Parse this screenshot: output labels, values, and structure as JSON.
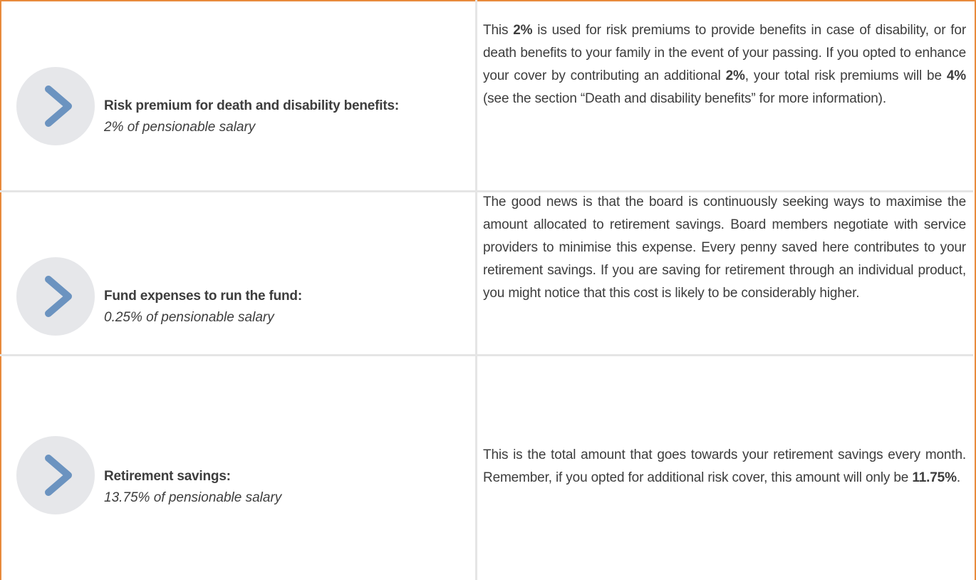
{
  "colors": {
    "border": "#e88a3c",
    "divider": "#e5e5e5",
    "chevron": "#6b93c0",
    "circle": "#e6e7ea"
  },
  "rows": [
    {
      "icon": "chevron-right-icon",
      "title": "Risk premium for death and disability benefits:",
      "subtitle": "2% of pensionable salary",
      "description_parts": [
        "This ",
        "2%",
        " is used for risk premiums to provide benefits in case of disability, or for death benefits to your family in the event of your passing. If you opted to enhance your cover by contributing an additional ",
        "2%",
        ", your total risk premiums will be ",
        "4%",
        " (see the section “Death and disability benefits” for more information)."
      ]
    },
    {
      "icon": "chevron-right-icon",
      "title": "Fund expenses to run the fund:",
      "subtitle": "0.25% of pensionable salary",
      "description": "The good news is that the board is continuously seeking ways to maximise the amount allocated to retirement savings. Board members negotiate with service providers to minimise this expense. Every penny saved here contributes to your retirement savings. If you are saving for retirement through an individual product, you might notice that this cost is likely to be considerably higher."
    },
    {
      "icon": "chevron-right-icon",
      "title": "Retirement savings:",
      "subtitle": "13.75% of pensionable salary",
      "description_parts": [
        "This is the total amount that goes towards your retirement savings every month.  Remember, if you opted for additional risk cover, this amount will only be ",
        "11.75%",
        "."
      ]
    }
  ]
}
